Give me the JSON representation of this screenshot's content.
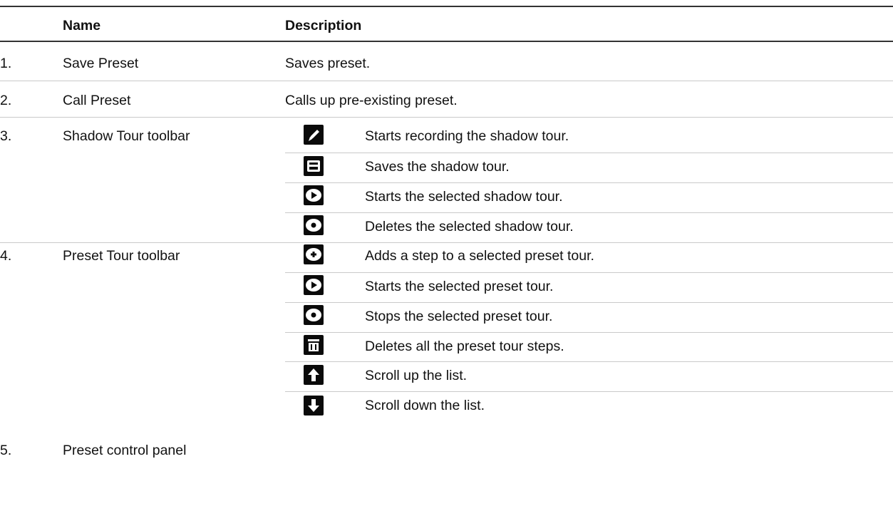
{
  "table": {
    "headers": {
      "number": "",
      "name": "Name",
      "description": "Description"
    },
    "rows": [
      {
        "number": "1.",
        "name": "Save Preset",
        "description": "Saves preset."
      },
      {
        "number": "2.",
        "name": "Call Preset",
        "description": "Calls up pre-existing preset."
      },
      {
        "number": "3.",
        "name": "Shadow Tour toolbar",
        "items": [
          {
            "icon": "pencil-icon",
            "description": "Starts recording the shadow tour."
          },
          {
            "icon": "save-icon",
            "description": "Saves the shadow tour."
          },
          {
            "icon": "play-icon",
            "description": "Starts the selected shadow tour."
          },
          {
            "icon": "stop-icon",
            "description": "Deletes the selected shadow tour."
          }
        ]
      },
      {
        "number": "4.",
        "name": "Preset Tour toolbar",
        "items": [
          {
            "icon": "add-icon",
            "description": "Adds a step to a selected preset tour."
          },
          {
            "icon": "play-icon",
            "description": "Starts the selected preset tour."
          },
          {
            "icon": "stop-icon",
            "description": "Stops the selected preset tour."
          },
          {
            "icon": "trash-icon",
            "description": "Deletes all the preset tour steps."
          },
          {
            "icon": "arrow-up-icon",
            "description": "Scroll up the list."
          },
          {
            "icon": "arrow-down-icon",
            "description": "Scroll down the list."
          }
        ]
      },
      {
        "number": "5.",
        "name": "Preset control panel",
        "description": ""
      }
    ]
  }
}
